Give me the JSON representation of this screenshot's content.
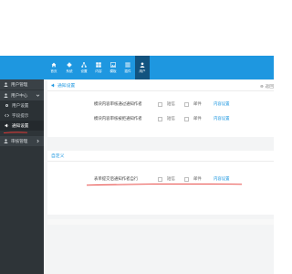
{
  "topnav": {
    "items": [
      {
        "label": "首页",
        "icon": "home-icon"
      },
      {
        "label": "系统",
        "icon": "gear-icon"
      },
      {
        "label": "设置",
        "icon": "sitemap-icon"
      },
      {
        "label": "内容",
        "icon": "grid-icon"
      },
      {
        "label": "模板",
        "icon": "image-icon"
      },
      {
        "label": "插件",
        "icon": "list-icon"
      },
      {
        "label": "用户",
        "icon": "user-icon"
      }
    ],
    "active_index": 6
  },
  "sidebar": {
    "sections": [
      {
        "label": "用户管理",
        "icon": "user-icon"
      },
      {
        "label": "用户中心",
        "icon": "user-icon"
      }
    ],
    "subitems": [
      {
        "label": "用户设置",
        "icon": "gear-icon"
      },
      {
        "label": "字段提示",
        "icon": "code-icon"
      },
      {
        "label": "通知设置",
        "icon": "volume-icon"
      }
    ],
    "active_subitem": 2,
    "bottom": {
      "label": "审核管理",
      "icon": "user-icon"
    }
  },
  "panel_top": {
    "title": "通知设置",
    "back": "返回",
    "rows": [
      {
        "description": "模块内容审核通过通知作者",
        "option1": "短信",
        "option2": "邮件",
        "config_link": "内容设置"
      },
      {
        "description": "模块内容审核被拒通知作者",
        "option1": "短信",
        "option2": "邮件",
        "config_link": "内容设置"
      }
    ]
  },
  "panel_bottom": {
    "title": "自定义",
    "rows": [
      {
        "description": "表单提交后通知作者自行",
        "option1": "短信",
        "option2": "邮件",
        "config_link": "内容设置"
      }
    ]
  },
  "colors": {
    "topbar": "#1e97e0",
    "topbar_active": "#12537f",
    "sidebar": "#2e3438",
    "accent_link": "#1e97e0",
    "annotation_red": "#e53935"
  }
}
